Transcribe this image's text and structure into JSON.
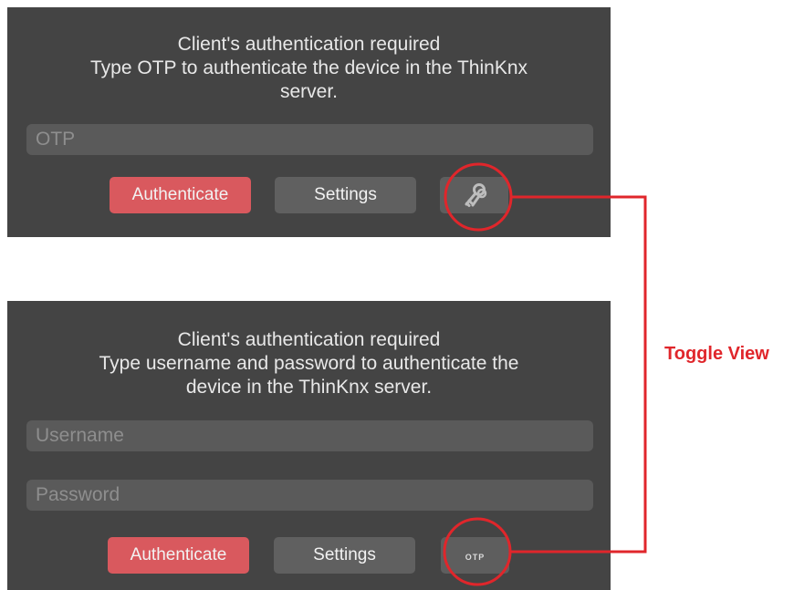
{
  "otp_panel": {
    "message_lines": [
      "Client's authentication required",
      "Type OTP to authenticate the device in the ThinKnx",
      "server."
    ],
    "otp_placeholder": "OTP",
    "authenticate_label": "Authenticate",
    "settings_label": "Settings",
    "toggle_icon": "keys-icon"
  },
  "user_panel": {
    "message_lines": [
      "Client's authentication required",
      "Type username and password to authenticate the",
      "device in the ThinKnx server."
    ],
    "username_placeholder": "Username",
    "password_placeholder": "Password",
    "authenticate_label": "Authenticate",
    "settings_label": "Settings",
    "toggle_label": "OTP"
  },
  "annotation": {
    "label": "Toggle View",
    "color": "#e0262b"
  },
  "colors": {
    "panel_bg": "#444444",
    "field_bg": "#5a5a5a",
    "authenticate_bg": "#d9595e",
    "settings_bg": "#606060"
  }
}
